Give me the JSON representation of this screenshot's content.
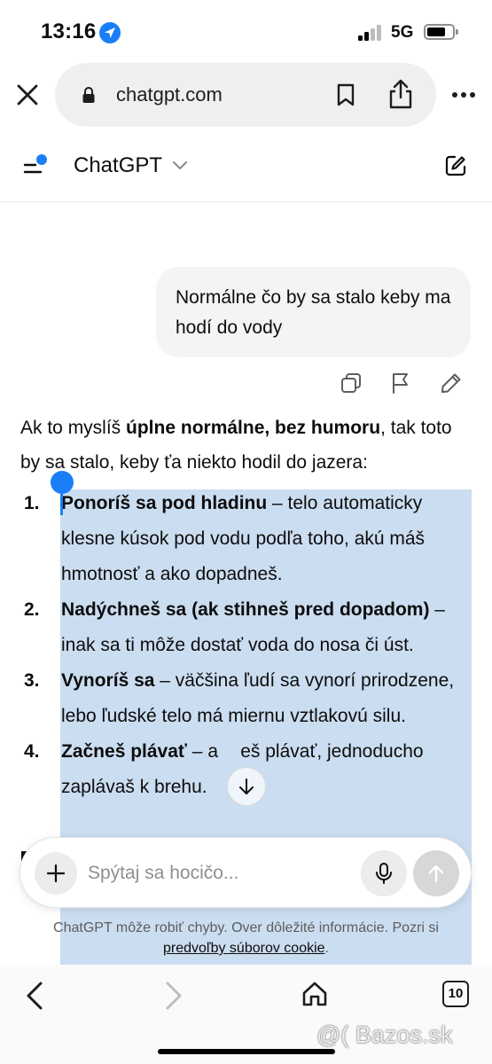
{
  "status_bar": {
    "time": "13:16",
    "network": "5G",
    "battery_level": 0.75
  },
  "browser": {
    "url": "chatgpt.com",
    "tab_count": "10"
  },
  "header": {
    "title": "ChatGPT"
  },
  "conversation": {
    "user_message": "Normálne čo by sa stalo keby ma hodí do vody",
    "assistant": {
      "intro": {
        "before": "Ak to myslíš ",
        "bold": "úplne normálne, bez humoru",
        "after": ", tak toto by sa stalo, keby ťa niekto hodil do jazera:"
      },
      "items": [
        {
          "num": "1.",
          "bold": "Ponoríš sa pod hladinu",
          "text": " – telo automaticky klesne kúsok pod vodu podľa toho, akú máš hmotnosť a ako dopadneš."
        },
        {
          "num": "2.",
          "bold": "Nadýchneš sa (ak stihneš pred dopadom)",
          "text": " – inak sa ti môže dostať voda do nosa či úst."
        },
        {
          "num": "3.",
          "bold": "Vynoríš sa",
          "text": " – väčšina ľudí sa vynorí prirodzene, lebo ľudské telo má miernu vztlakovú silu."
        },
        {
          "num": "4.",
          "bold": "Začneš plávať",
          "text": " – a      eš plávať, jednoducho zaplávaš k brehu."
        }
      ]
    }
  },
  "composer": {
    "placeholder": "Spýtaj sa hocičo..."
  },
  "disclaimer": {
    "text": "ChatGPT môže robiť chyby. Over dôležité informácie. Pozri si ",
    "link": "predvoľby súborov cookie",
    "end": "."
  },
  "watermark": "@( Bazos.sk",
  "colors": {
    "accent": "#1a7ff7",
    "selection": "#3e80c6",
    "bubble": "#f4f4f4"
  }
}
